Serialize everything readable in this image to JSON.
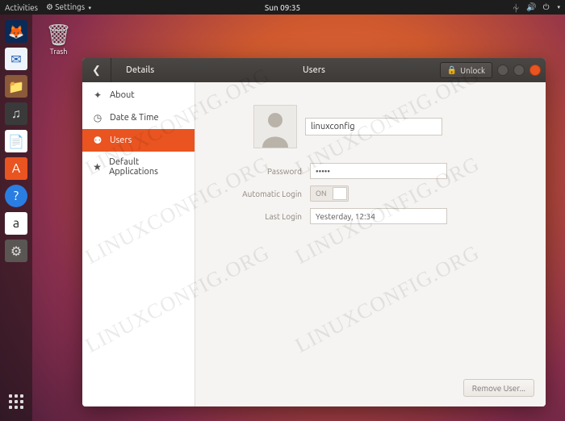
{
  "top_panel": {
    "activities": "Activities",
    "app_menu": "Settings",
    "clock": "Sun 09:35"
  },
  "desktop": {
    "trash_label": "Trash"
  },
  "window": {
    "section": "Details",
    "title": "Users",
    "unlock_label": "Unlock"
  },
  "sidebar": {
    "items": [
      {
        "icon": "✦",
        "label": "About"
      },
      {
        "icon": "◷",
        "label": "Date & Time"
      },
      {
        "icon": "⚉",
        "label": "Users"
      },
      {
        "icon": "★",
        "label": "Default Applications"
      }
    ],
    "active_index": 2
  },
  "user": {
    "name": "linuxconfig",
    "password_label": "Password",
    "password_value": "•••••",
    "auto_login_label": "Automatic Login",
    "auto_login_value": "ON",
    "last_login_label": "Last Login",
    "last_login_value": "Yesterday, 12:34",
    "remove_button": "Remove User..."
  },
  "watermark": "LINUXCONFIG.ORG"
}
